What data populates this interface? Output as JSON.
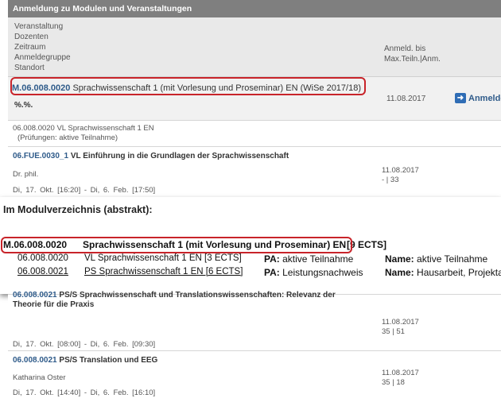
{
  "panel": {
    "header": "Anmeldung zu Modulen und Veranstaltungen",
    "columns_left": [
      "Veranstaltung",
      "Dozenten",
      "Zeitraum",
      "Anmeldegruppe",
      "Standort"
    ],
    "columns_right": [
      "Anmeld. bis",
      "Max.Teiln.|Anm."
    ]
  },
  "module": {
    "code": "M.06.008.0020",
    "title": "Sprachwissenschaft 1 (mit Vorlesung und Proseminar) EN (WiSe 2017/18)",
    "placeholder": "%.%.",
    "deadline": "11.08.2017",
    "register_label": "Anmelden",
    "register_icon": "arrow-right-icon"
  },
  "sub_entry": {
    "line1": "06.008.0020 VL Sprachwissenschaft 1 EN",
    "line2": "(Prüfungen: aktive Teilnahme)"
  },
  "event1": {
    "code": "06.FUE.0030_1",
    "title": "VL Einführung in die Grundlagen der Sprachwissenschaft",
    "lecturer": "Dr. phil.",
    "time": "Di, 17. Okt.    [16:20] - Di, 6. Feb.    [17:50]",
    "deadline": "11.08.2017",
    "capacity": "- | 33"
  },
  "overlay": {
    "heading": "Im Modulverzeichnis (abstrakt):",
    "main_code": "M.06.008.0020",
    "main_title": "Sprachwissenschaft 1 (mit Vorlesung und Proseminar) EN",
    "main_ects": "[9 ECTS]",
    "rows": [
      {
        "code": "06.008.0020",
        "title": "VL Sprachwissenschaft 1 EN [3 ECTS]",
        "pa_label": "PA:",
        "pa_value": "aktive Teilnahme",
        "name_label": "Name:",
        "name_value": "aktive Teilnahme"
      },
      {
        "code": "06.008.0021",
        "title": "PS Sprachwissenschaft 1 EN [6 ECTS]",
        "pa_label": "PA:",
        "pa_value": "Leistungsnachweis",
        "name_label": "Name:",
        "name_value": "Hausarbeit, Projekta"
      }
    ]
  },
  "event2": {
    "code": "06.008.0021",
    "title_line1": "PS/S Sprachwissenschaft und Translationswissenschaften: Relevanz der",
    "title_line2": "Theorie für die Praxis",
    "time": "Di, 17. Okt.    [08:00] - Di, 6. Feb.    [09:30]",
    "deadline": "11.08.2017",
    "capacity": "35 | 51"
  },
  "event3": {
    "code": "06.008.0021",
    "title": "PS/S Translation und EEG",
    "lecturer": "Katharina Oster",
    "time": "Di, 17. Okt.    [14:40] - Di, 6. Feb.    [16:10]",
    "deadline": "11.08.2017",
    "capacity": "35 | 18"
  },
  "colors": {
    "header_bg": "#7f7f7f",
    "link_blue": "#2f5b8a",
    "highlight_red": "#c8242a",
    "row_bg": "#f1f1f1"
  }
}
